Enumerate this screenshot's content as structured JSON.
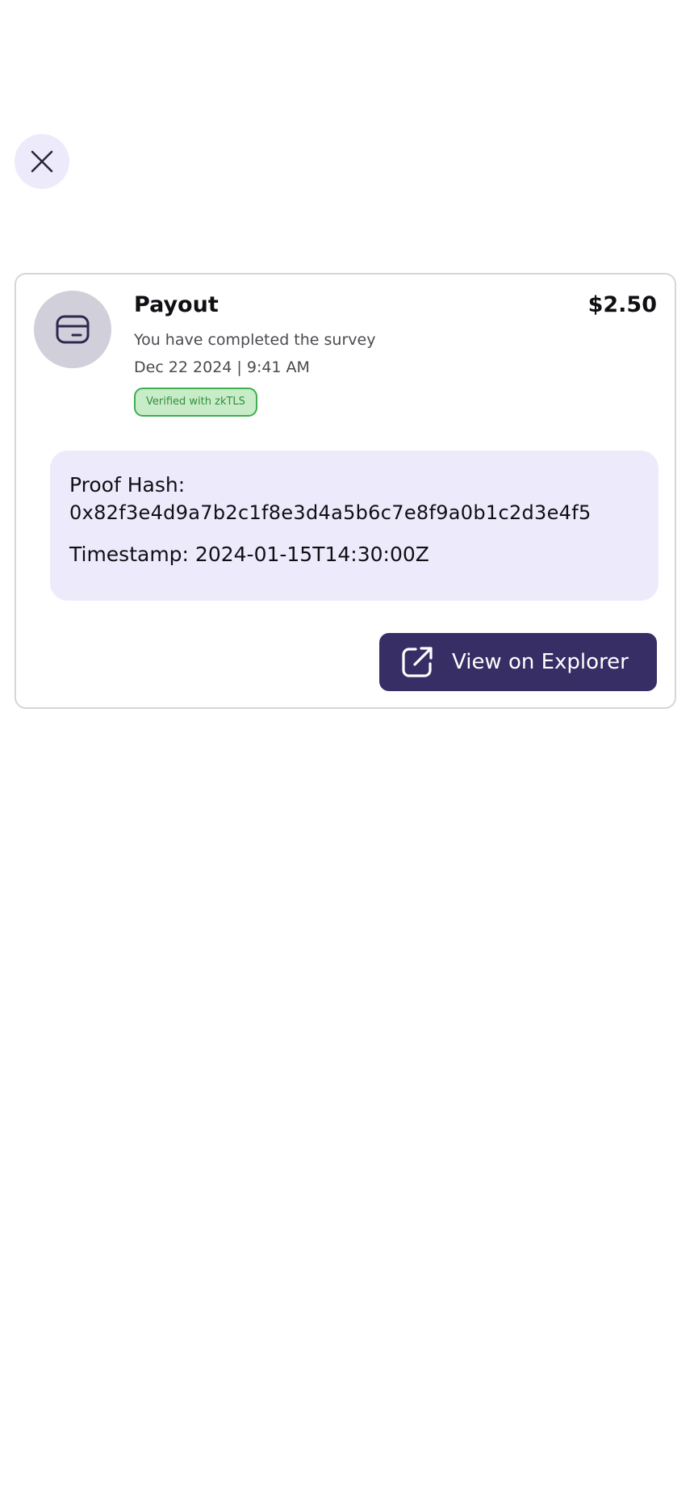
{
  "header": {
    "close_icon": "close-icon"
  },
  "transaction": {
    "icon": "wallet-icon",
    "title": "Payout",
    "amount": "$2.50",
    "description": "You have completed the survey",
    "date": "Dec 22 2024 | 9:41 AM",
    "badge": "Verified with zkTLS"
  },
  "proof": {
    "hash_label": "Proof Hash:",
    "hash_value": "0x82f3e4d9a7b2c1f8e3d4a5b6c7e8f9a0b1c2d3e4f5",
    "timestamp_text": "Timestamp: 2024-01-15T14:30:00Z"
  },
  "actions": {
    "explorer_label": "View on Explorer",
    "explorer_icon": "external-link-icon"
  },
  "colors": {
    "accent": "#382e66",
    "proof_bg": "#edebfb",
    "badge_bg": "#c9ecc8",
    "badge_border": "#3fae4f"
  }
}
